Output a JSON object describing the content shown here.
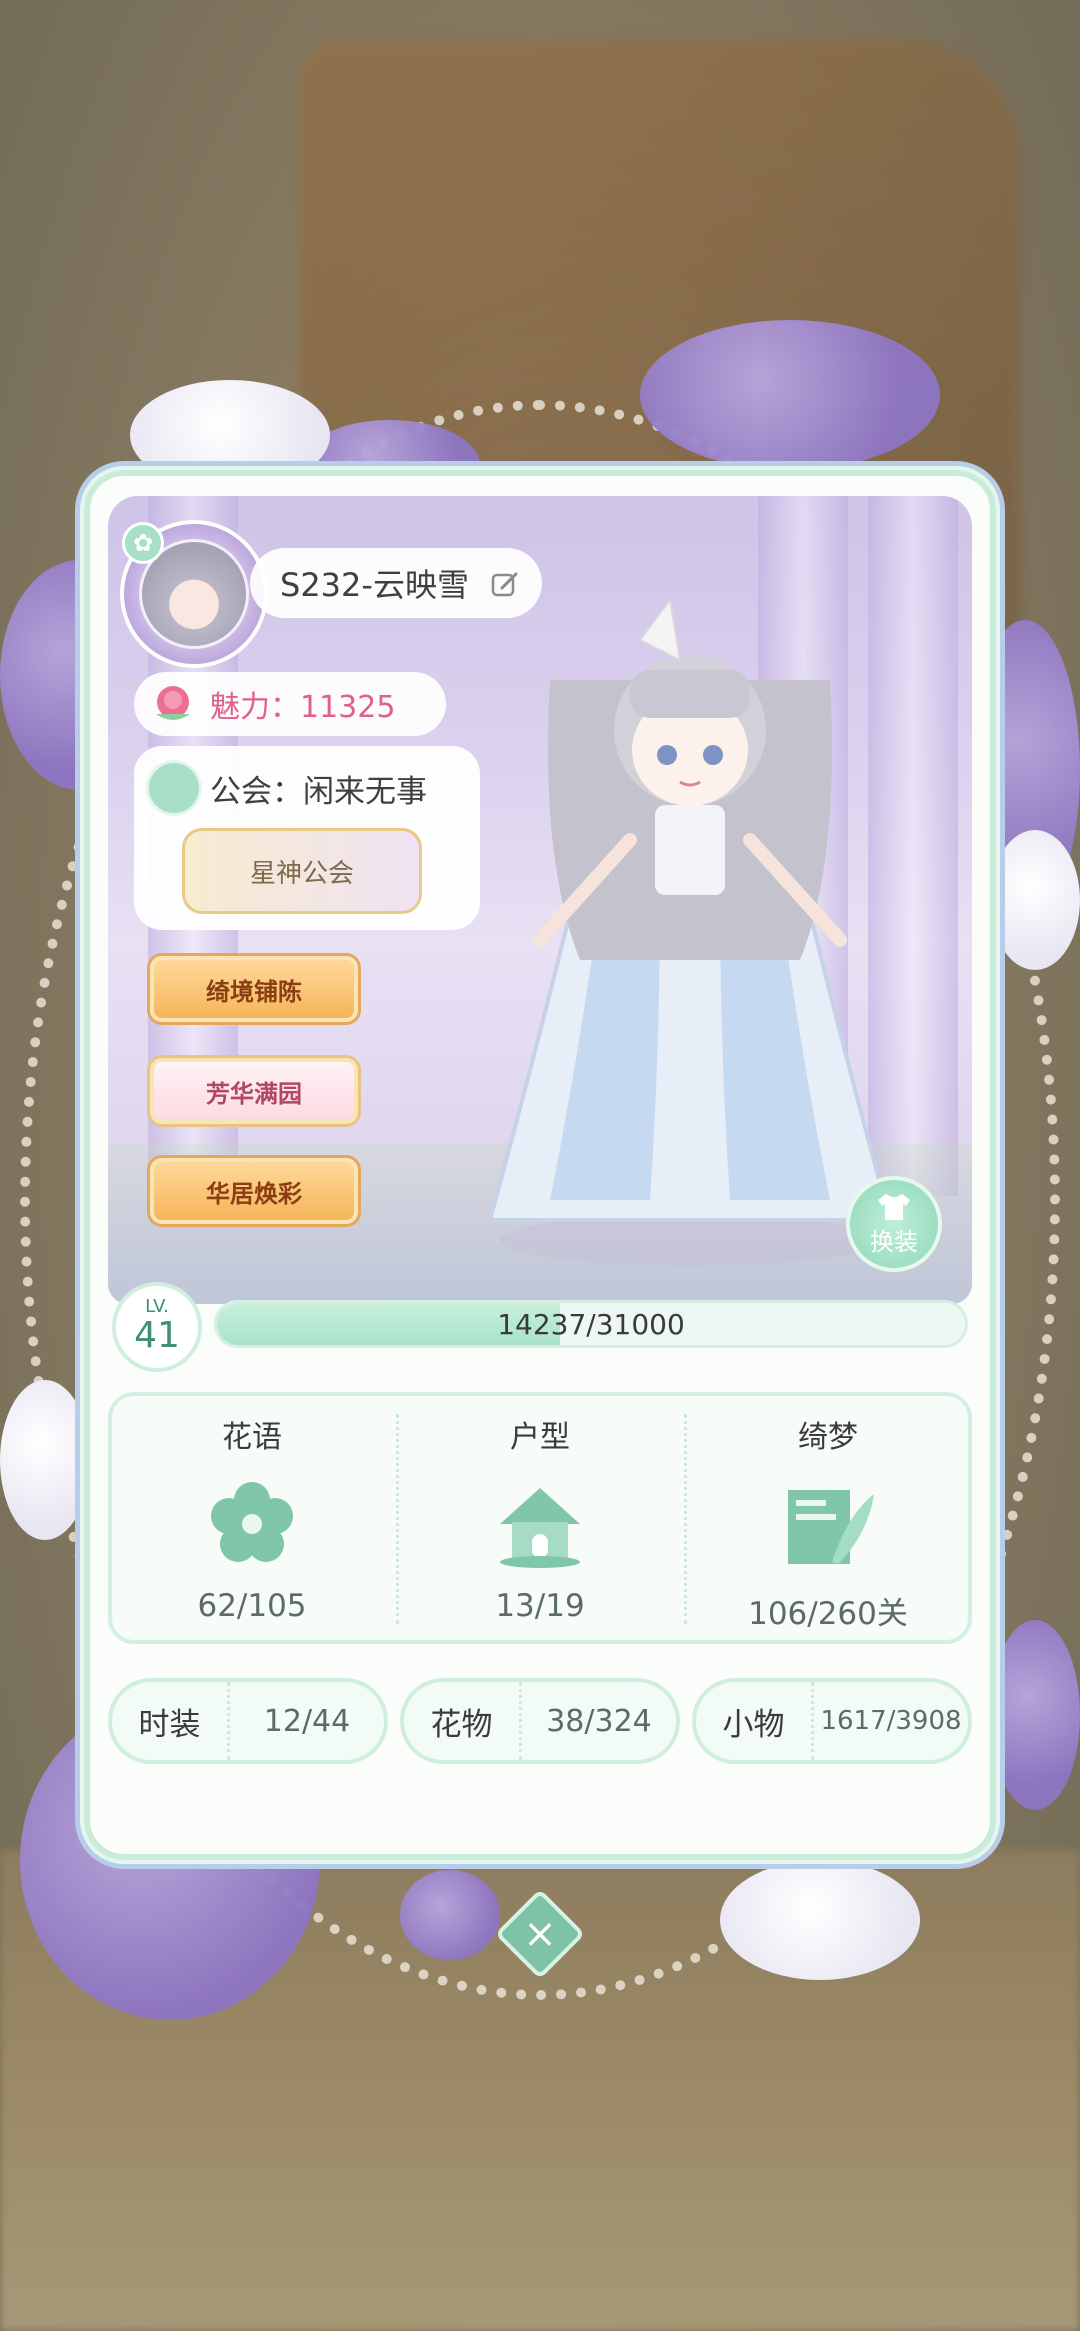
{
  "profile": {
    "server_name": "S232-云映雪",
    "charm_label": "魅力：11325",
    "guild_label": "公会：闲来无事",
    "guild_emblem": "星神公会"
  },
  "activity_buttons": [
    "绮境铺陈",
    "芳华满园",
    "华居焕彩"
  ],
  "change_outfit_label": "换装",
  "level": {
    "lv_label": "LV.",
    "lv_value": "41",
    "xp_text": "14237/31000",
    "xp_fraction": 0.459
  },
  "stats": [
    {
      "title": "花语",
      "value": "62/105",
      "icon": "flower-icon"
    },
    {
      "title": "户型",
      "value": "13/19",
      "icon": "house-icon"
    },
    {
      "title": "绮梦",
      "value": "106/260关",
      "icon": "letter-quill-icon"
    }
  ],
  "collections": [
    {
      "key": "时装",
      "value": "12/44"
    },
    {
      "key": "花物",
      "value": "38/324"
    },
    {
      "key": "小物",
      "value": "1617/3908"
    }
  ],
  "colors": {
    "accent_green": "#8fd8b8",
    "charm_pink": "#e0608a",
    "frame_purple": "#8e75c4"
  }
}
